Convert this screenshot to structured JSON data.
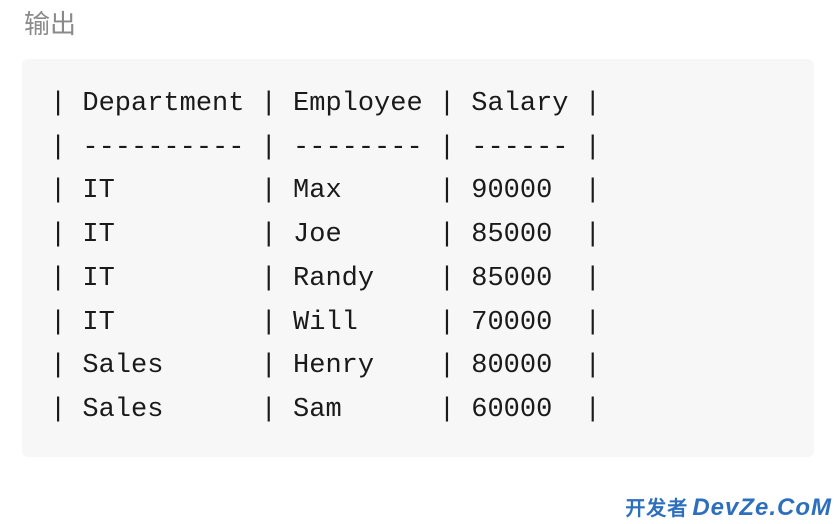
{
  "heading": "输出",
  "table": {
    "header_line": "| Department | Employee | Salary |",
    "separator_line": "| ---------- | -------- | ------ |",
    "rows": [
      "| IT         | Max      | 90000  |",
      "| IT         | Joe      | 85000  |",
      "| IT         | Randy    | 85000  |",
      "| IT         | Will     | 70000  |",
      "| Sales      | Henry    | 80000  |",
      "| Sales      | Sam      | 60000  |"
    ]
  },
  "chart_data": {
    "type": "table",
    "columns": [
      "Department",
      "Employee",
      "Salary"
    ],
    "rows": [
      {
        "Department": "IT",
        "Employee": "Max",
        "Salary": 90000
      },
      {
        "Department": "IT",
        "Employee": "Joe",
        "Salary": 85000
      },
      {
        "Department": "IT",
        "Employee": "Randy",
        "Salary": 85000
      },
      {
        "Department": "IT",
        "Employee": "Will",
        "Salary": 70000
      },
      {
        "Department": "Sales",
        "Employee": "Henry",
        "Salary": 80000
      },
      {
        "Department": "Sales",
        "Employee": "Sam",
        "Salary": 60000
      }
    ]
  },
  "watermark": {
    "cn": "开发者",
    "brand": "DevZe.CoM"
  }
}
